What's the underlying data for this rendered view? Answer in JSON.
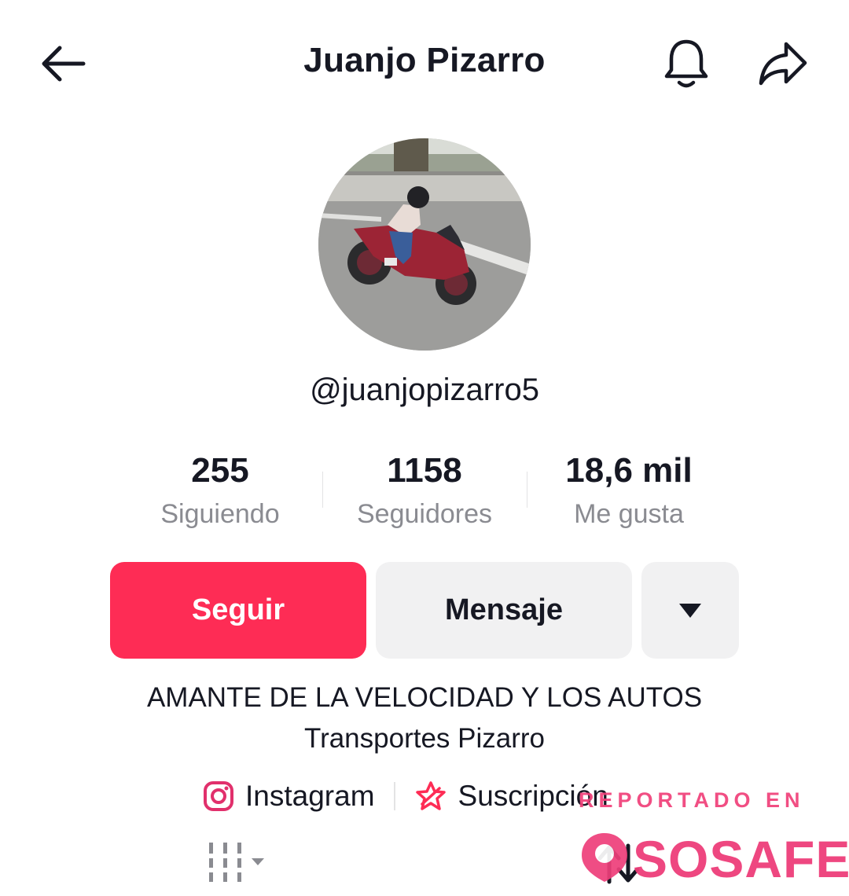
{
  "header": {
    "title": "Juanjo Pizarro",
    "back_icon": "arrow-left-icon",
    "bell_icon": "bell-icon",
    "share_icon": "share-icon"
  },
  "profile": {
    "username": "@juanjopizarro5",
    "avatar": "motorcycle-rider-photo"
  },
  "stats": [
    {
      "value": "255",
      "label": "Siguiendo"
    },
    {
      "value": "1158",
      "label": "Seguidores"
    },
    {
      "value": "18,6 mil",
      "label": "Me gusta"
    }
  ],
  "actions": {
    "follow_label": "Seguir",
    "message_label": "Mensaje",
    "more_icon": "caret-down-icon"
  },
  "bio": {
    "line1": "AMANTE DE LA VELOCIDAD Y LOS AUTOS",
    "line2": "Transportes Pizarro"
  },
  "links": {
    "instagram_label": "Instagram",
    "subscription_label": "Suscripción"
  },
  "watermark": {
    "top_text": "REPORTADO EN",
    "logo_text": "SOSAFE"
  },
  "colors": {
    "accent": "#fe2c55",
    "secondary_button": "#f1f1f2",
    "muted_text": "#8a8b91",
    "watermark": "#ee3e7a"
  }
}
